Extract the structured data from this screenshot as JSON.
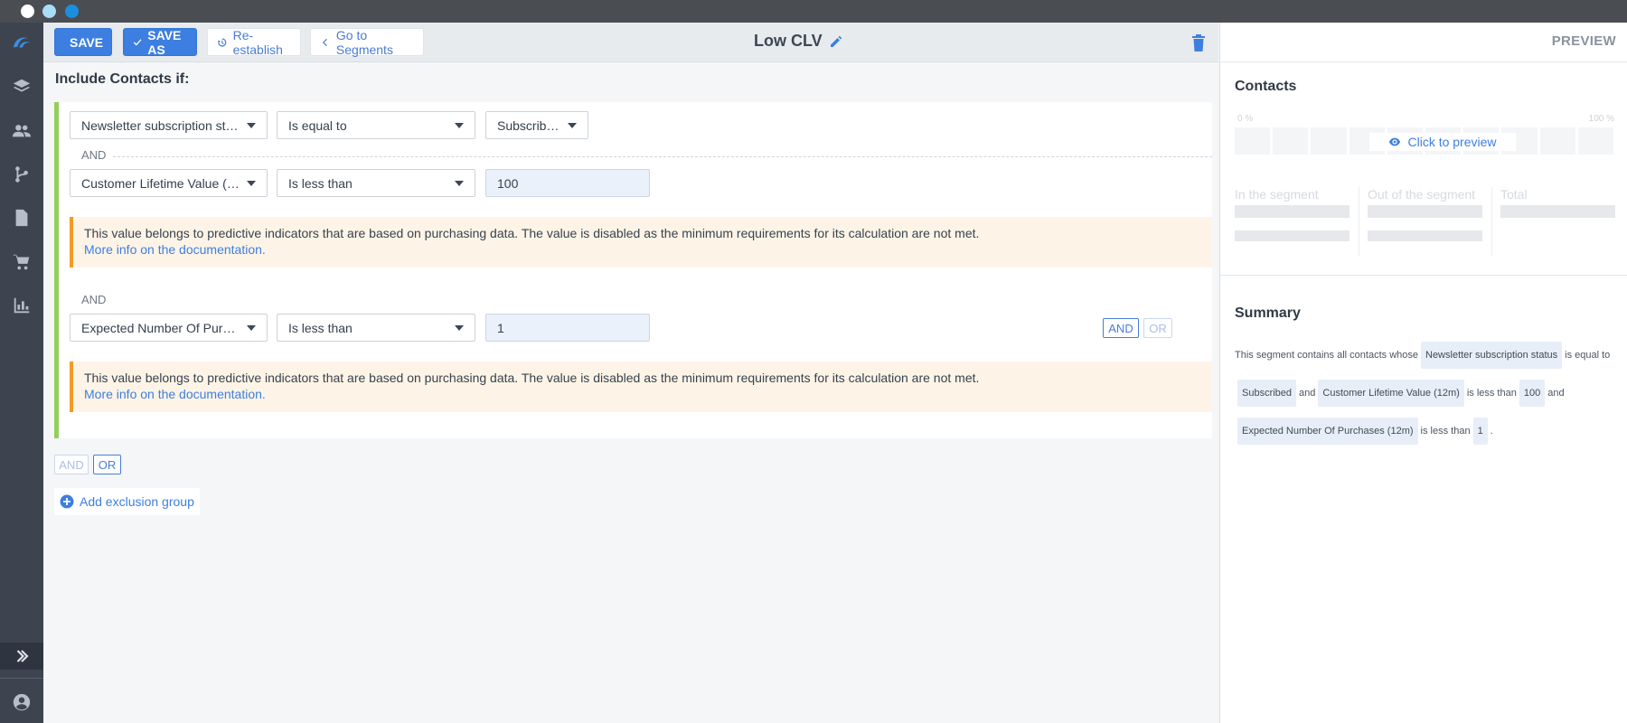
{
  "toolbar": {
    "save_label": "SAVE",
    "save_as_label": "SAVE AS",
    "reestablish_label": "Re-establish",
    "goto_label": "Go to Segments",
    "segment_title": "Low CLV"
  },
  "editor": {
    "include_label": "Include Contacts if:",
    "conditions": [
      {
        "field": "Newsletter subscription status",
        "operator": "Is equal to",
        "value": "Subscribed"
      },
      {
        "field": "Customer Lifetime Value (12m)",
        "operator": "Is less than",
        "value": "100"
      },
      {
        "field": "Expected Number Of Purchases (12m)",
        "operator": "Is less than",
        "value": "1"
      }
    ],
    "and_label": "AND",
    "or_label": "OR",
    "warning_text": "This value belongs to predictive indicators that are based on purchasing data. The value is disabled as the minimum requirements for its calculation are not met.",
    "warning_link": "More info on the documentation.",
    "add_exclusion_label": "Add exclusion group"
  },
  "preview": {
    "header": "PREVIEW",
    "contacts_title": "Contacts",
    "pct_min": "0 %",
    "pct_max": "100 %",
    "click_to_preview": "Click to preview",
    "in_segment": "In the segment",
    "out_segment": "Out of the segment",
    "total": "Total",
    "summary_title": "Summary",
    "summary": {
      "intro": "This segment contains all contacts whose",
      "c1_field": "Newsletter subscription status",
      "c1_op": "is equal to",
      "c1_val": "Subscribed",
      "and1": "and",
      "c2_field": "Customer Lifetime Value (12m)",
      "c2_op": "is less than",
      "c2_val": "100",
      "and2": "and",
      "c3_field": "Expected Number Of Purchases (12m)",
      "c3_op": "is less than",
      "c3_val": "1",
      "end": "."
    }
  },
  "colors": {
    "accent": "#3d7fe0",
    "group_border": "#93cf5b",
    "warning_border": "#f29b25",
    "rail": "#3d4450"
  }
}
